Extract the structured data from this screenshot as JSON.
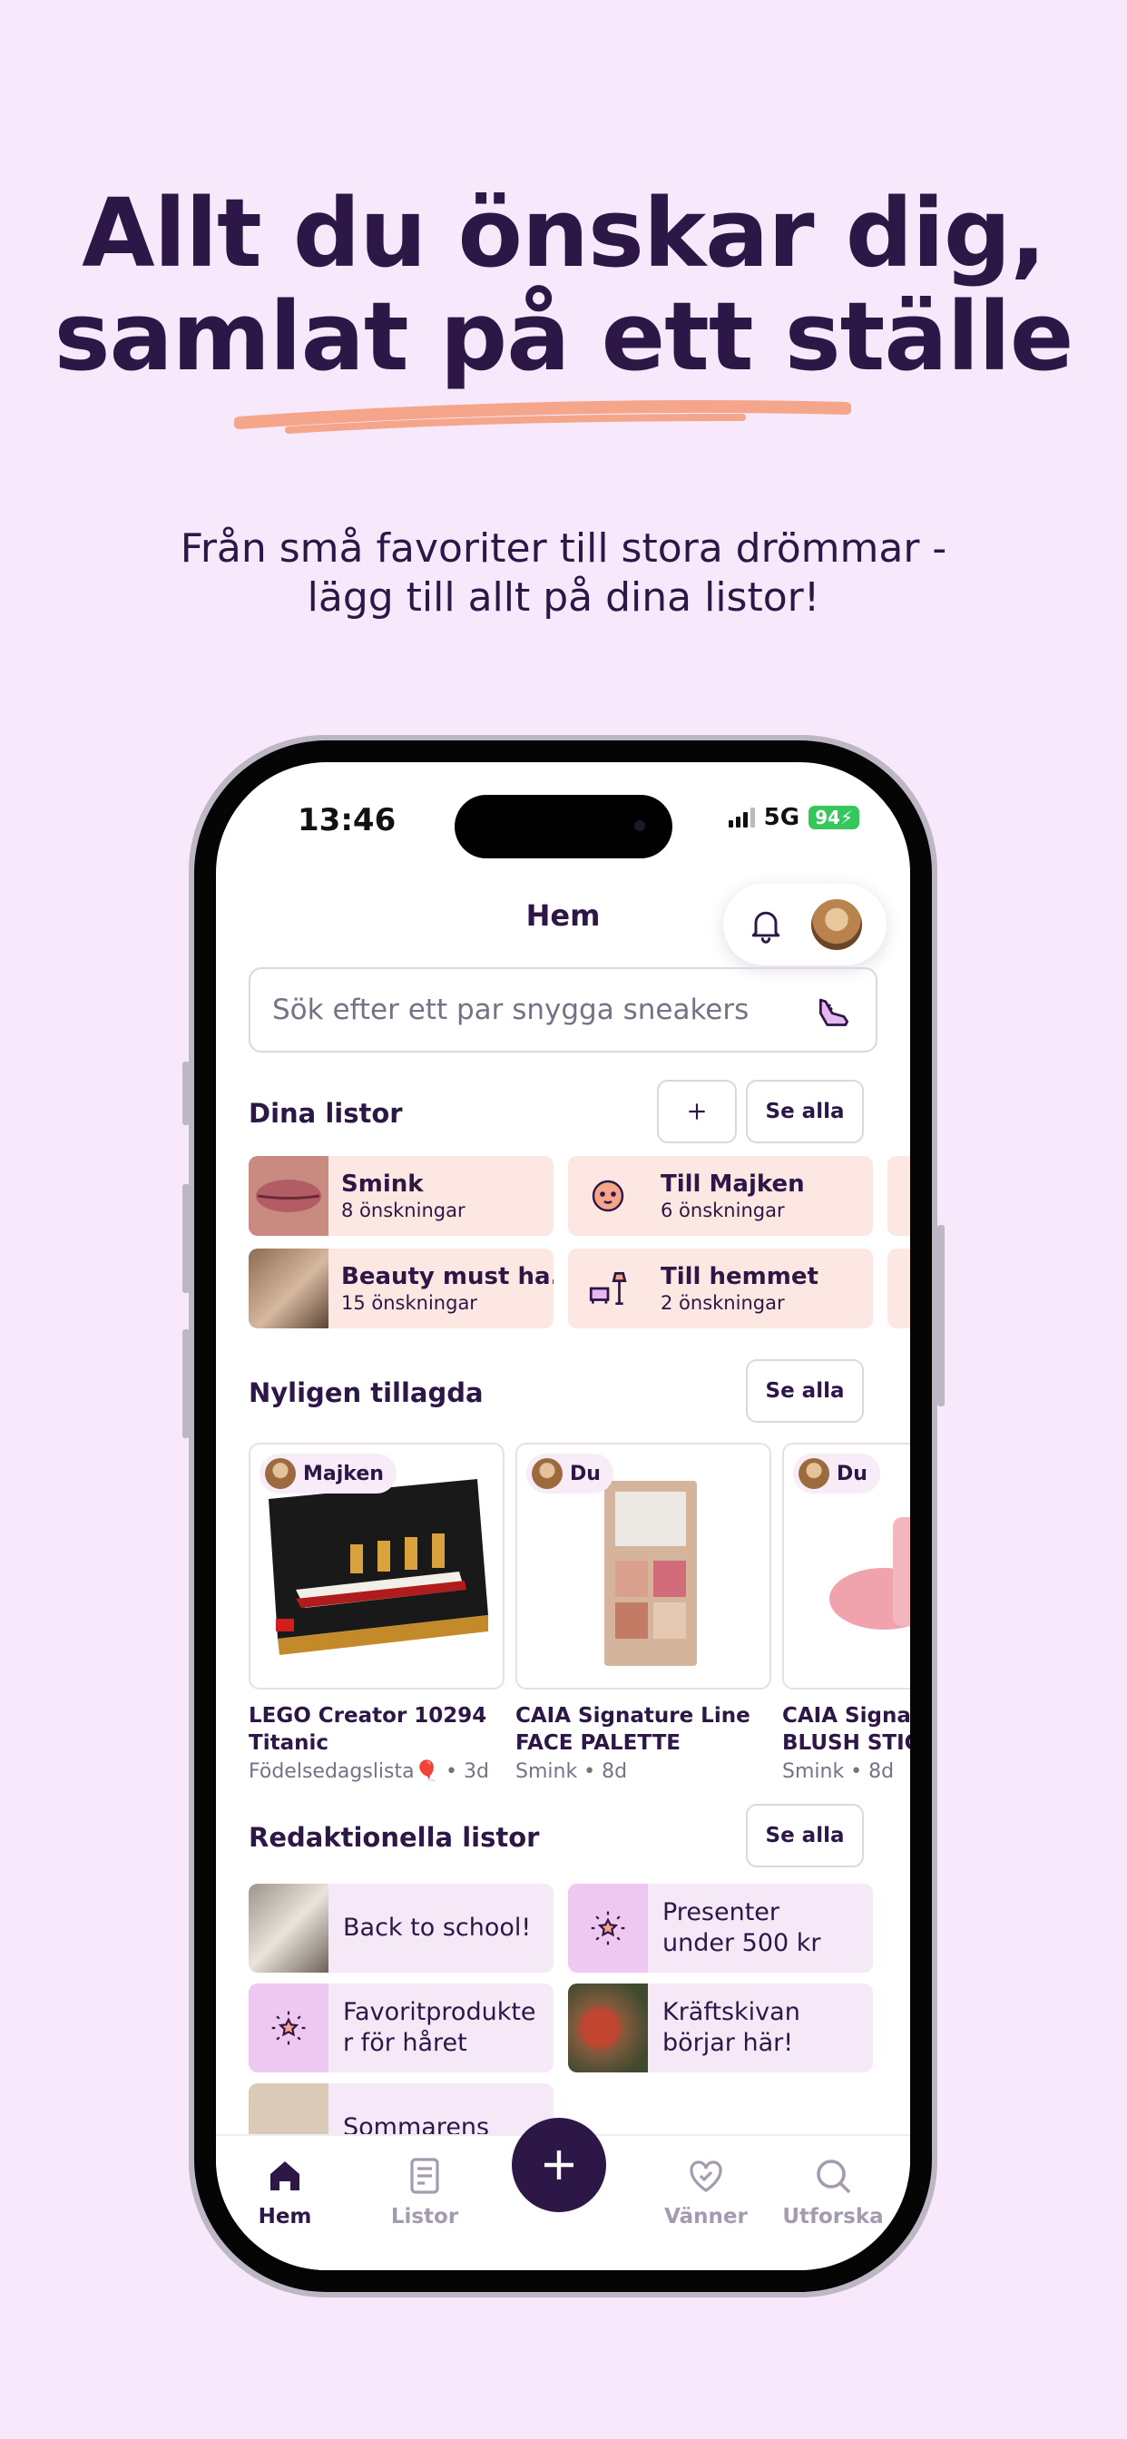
{
  "headline": {
    "line1": "Allt du önskar dig,",
    "line2": "samlat på ett ställe",
    "underline_color": "#f4a58a"
  },
  "subtitle": {
    "line1": "Från små favoriter till stora drömmar -",
    "line2": "lägg till allt på dina listor!"
  },
  "status_bar": {
    "time": "13:46",
    "network": "5G",
    "battery": "94"
  },
  "header": {
    "title": "Hem"
  },
  "search": {
    "placeholder": "Sök efter ett par snygga sneakers"
  },
  "lists": {
    "title": "Dina listor",
    "see_all": "Se alla",
    "items": [
      {
        "title": "Smink",
        "subtitle": "8 önskningar"
      },
      {
        "title": "Till Majken",
        "subtitle": "6 önskningar"
      },
      {
        "title": "Beauty must ha...",
        "subtitle": "15 önskningar"
      },
      {
        "title": "Till hemmet",
        "subtitle": "2 önskningar"
      }
    ]
  },
  "recent": {
    "title": "Nyligen tillagda",
    "see_all": "Se alla",
    "items": [
      {
        "owner": "Majken",
        "title1": "LEGO Creator 10294",
        "title2": "Titanic",
        "meta": "Födelsedagslista🎈 • 3d"
      },
      {
        "owner": "Du",
        "title1": "CAIA Signature Line",
        "title2": "FACE PALETTE",
        "meta": "Smink • 8d"
      },
      {
        "owner": "Du",
        "title1": "CAIA Signat",
        "title2": "BLUSH STIC",
        "meta": "Smink • 8d"
      }
    ]
  },
  "editorial": {
    "title": "Redaktionella listor",
    "see_all": "Se alla",
    "items": [
      {
        "l1": "Back to school!",
        "l2": ""
      },
      {
        "l1": "Presenter",
        "l2": "under 500 kr"
      },
      {
        "l1": "Favoritprodukte",
        "l2": "r för håret"
      },
      {
        "l1": "Kräftskivan",
        "l2": "börjar här!"
      },
      {
        "l1": "Sommarens",
        "l2": ""
      }
    ]
  },
  "tabbar": {
    "home": "Hem",
    "lists": "Listor",
    "friends": "Vänner",
    "explore": "Utforska"
  },
  "colors": {
    "background": "#f8e8fb",
    "primary": "#2c1746",
    "card_peach": "#fde7e2",
    "card_lilac": "#f6e9f7"
  }
}
